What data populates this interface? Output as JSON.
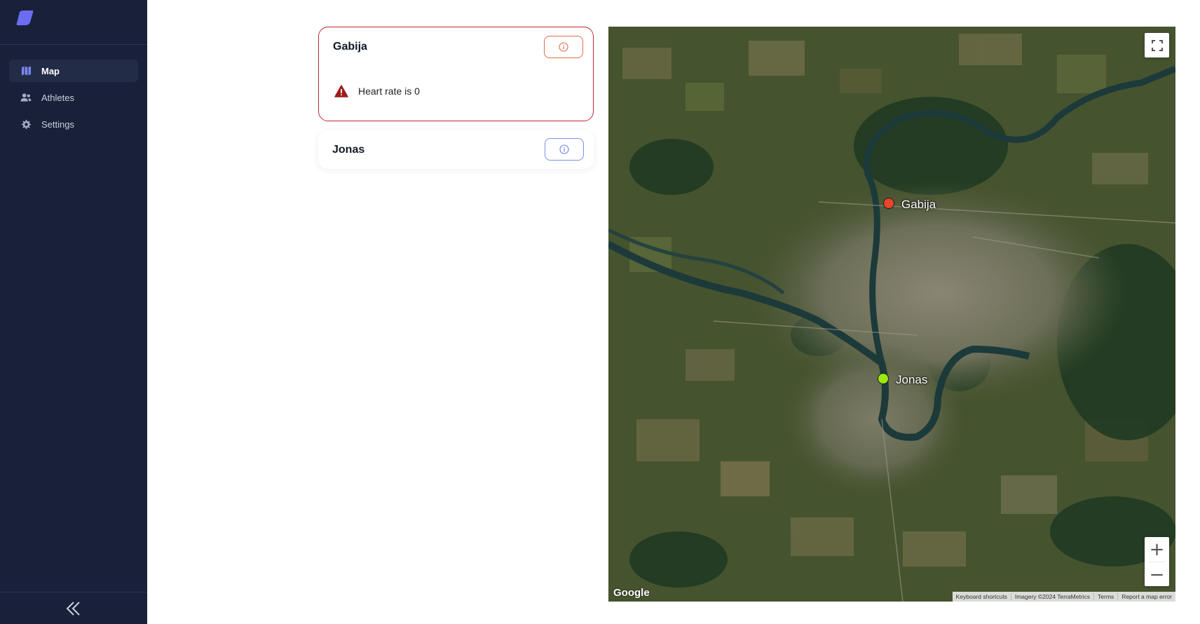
{
  "sidebar": {
    "logo_icon": "app-logo-icon",
    "items": [
      {
        "label": "Map",
        "icon": "map-icon",
        "active": true
      },
      {
        "label": "Athletes",
        "icon": "users-icon",
        "active": false
      },
      {
        "label": "Settings",
        "icon": "gear-icon",
        "active": false
      }
    ],
    "collapse_icon": "double-chevron-left-icon"
  },
  "athletes": [
    {
      "name": "Gabija",
      "status": "alert",
      "alert_message": "Heart rate is 0",
      "alert_icon": "warning-triangle-icon"
    },
    {
      "name": "Jonas",
      "status": "ok"
    }
  ],
  "map": {
    "markers": [
      {
        "label": "Gabija",
        "color": "#e8452b"
      },
      {
        "label": "Jonas",
        "color": "#9be80e"
      }
    ],
    "zoom_in_label": "+",
    "zoom_out_label": "−",
    "google_logo": "Google",
    "attribution": [
      "Keyboard shortcuts",
      "Imagery ©2024 TerraMetrics",
      "Terms",
      "Report a map error"
    ]
  },
  "colors": {
    "sidebar_bg": "#19213a",
    "alert_border": "#c0292f",
    "info_button_alert": "#e46a4a",
    "info_button_ok": "#7b8fe8",
    "accent": "#6c6cf0"
  }
}
